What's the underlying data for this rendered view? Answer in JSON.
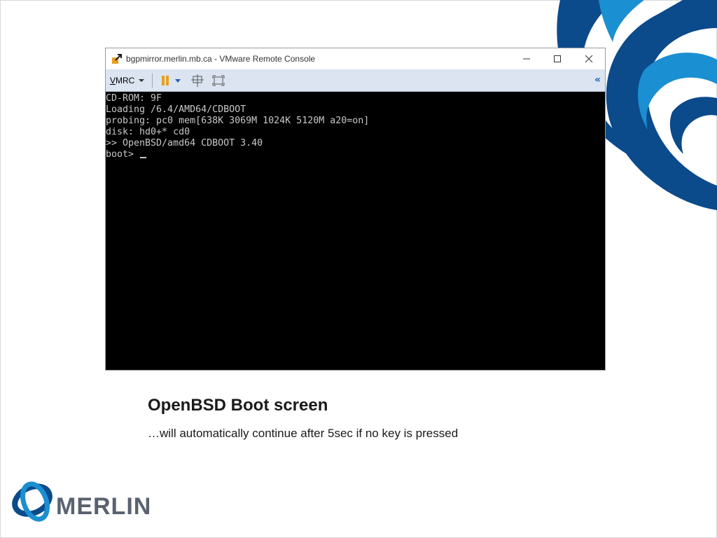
{
  "window": {
    "title": "bgpmirror.merlin.mb.ca - VMware Remote Console",
    "controls": [
      "minimize-icon",
      "maximize-icon",
      "close-icon"
    ]
  },
  "toolbar": {
    "vmrc_prefix": "V",
    "vmrc_rest": "MRC",
    "icons": [
      "pause-icon",
      "dropdown-arrow-icon",
      "send-ctrl-alt-del-icon",
      "fullscreen-icon",
      "collapse-icon"
    ],
    "collapse_glyph": "«"
  },
  "console": {
    "lines": [
      "CD-ROM: 9F",
      "Loading /6.4/AMD64/CDBOOT",
      "probing: pc0 mem[638K 3069M 1024K 5120M a20=on]",
      "disk: hd0+* cd0",
      ">> OpenBSD/amd64 CDBOOT 3.40",
      "boot> "
    ]
  },
  "caption": {
    "title": "OpenBSD Boot screen",
    "subtitle": "…will automatically continue after 5sec if no key is pressed"
  },
  "logo": {
    "text": "MERLIN"
  },
  "colors": {
    "brand_dark_blue": "#0b4a8b",
    "brand_light_blue": "#1a8fd1",
    "toolbar_bg": "#dbe4f0",
    "console_bg": "#000000",
    "console_fg": "#c8c8c8",
    "pause_orange": "#e8a020"
  }
}
